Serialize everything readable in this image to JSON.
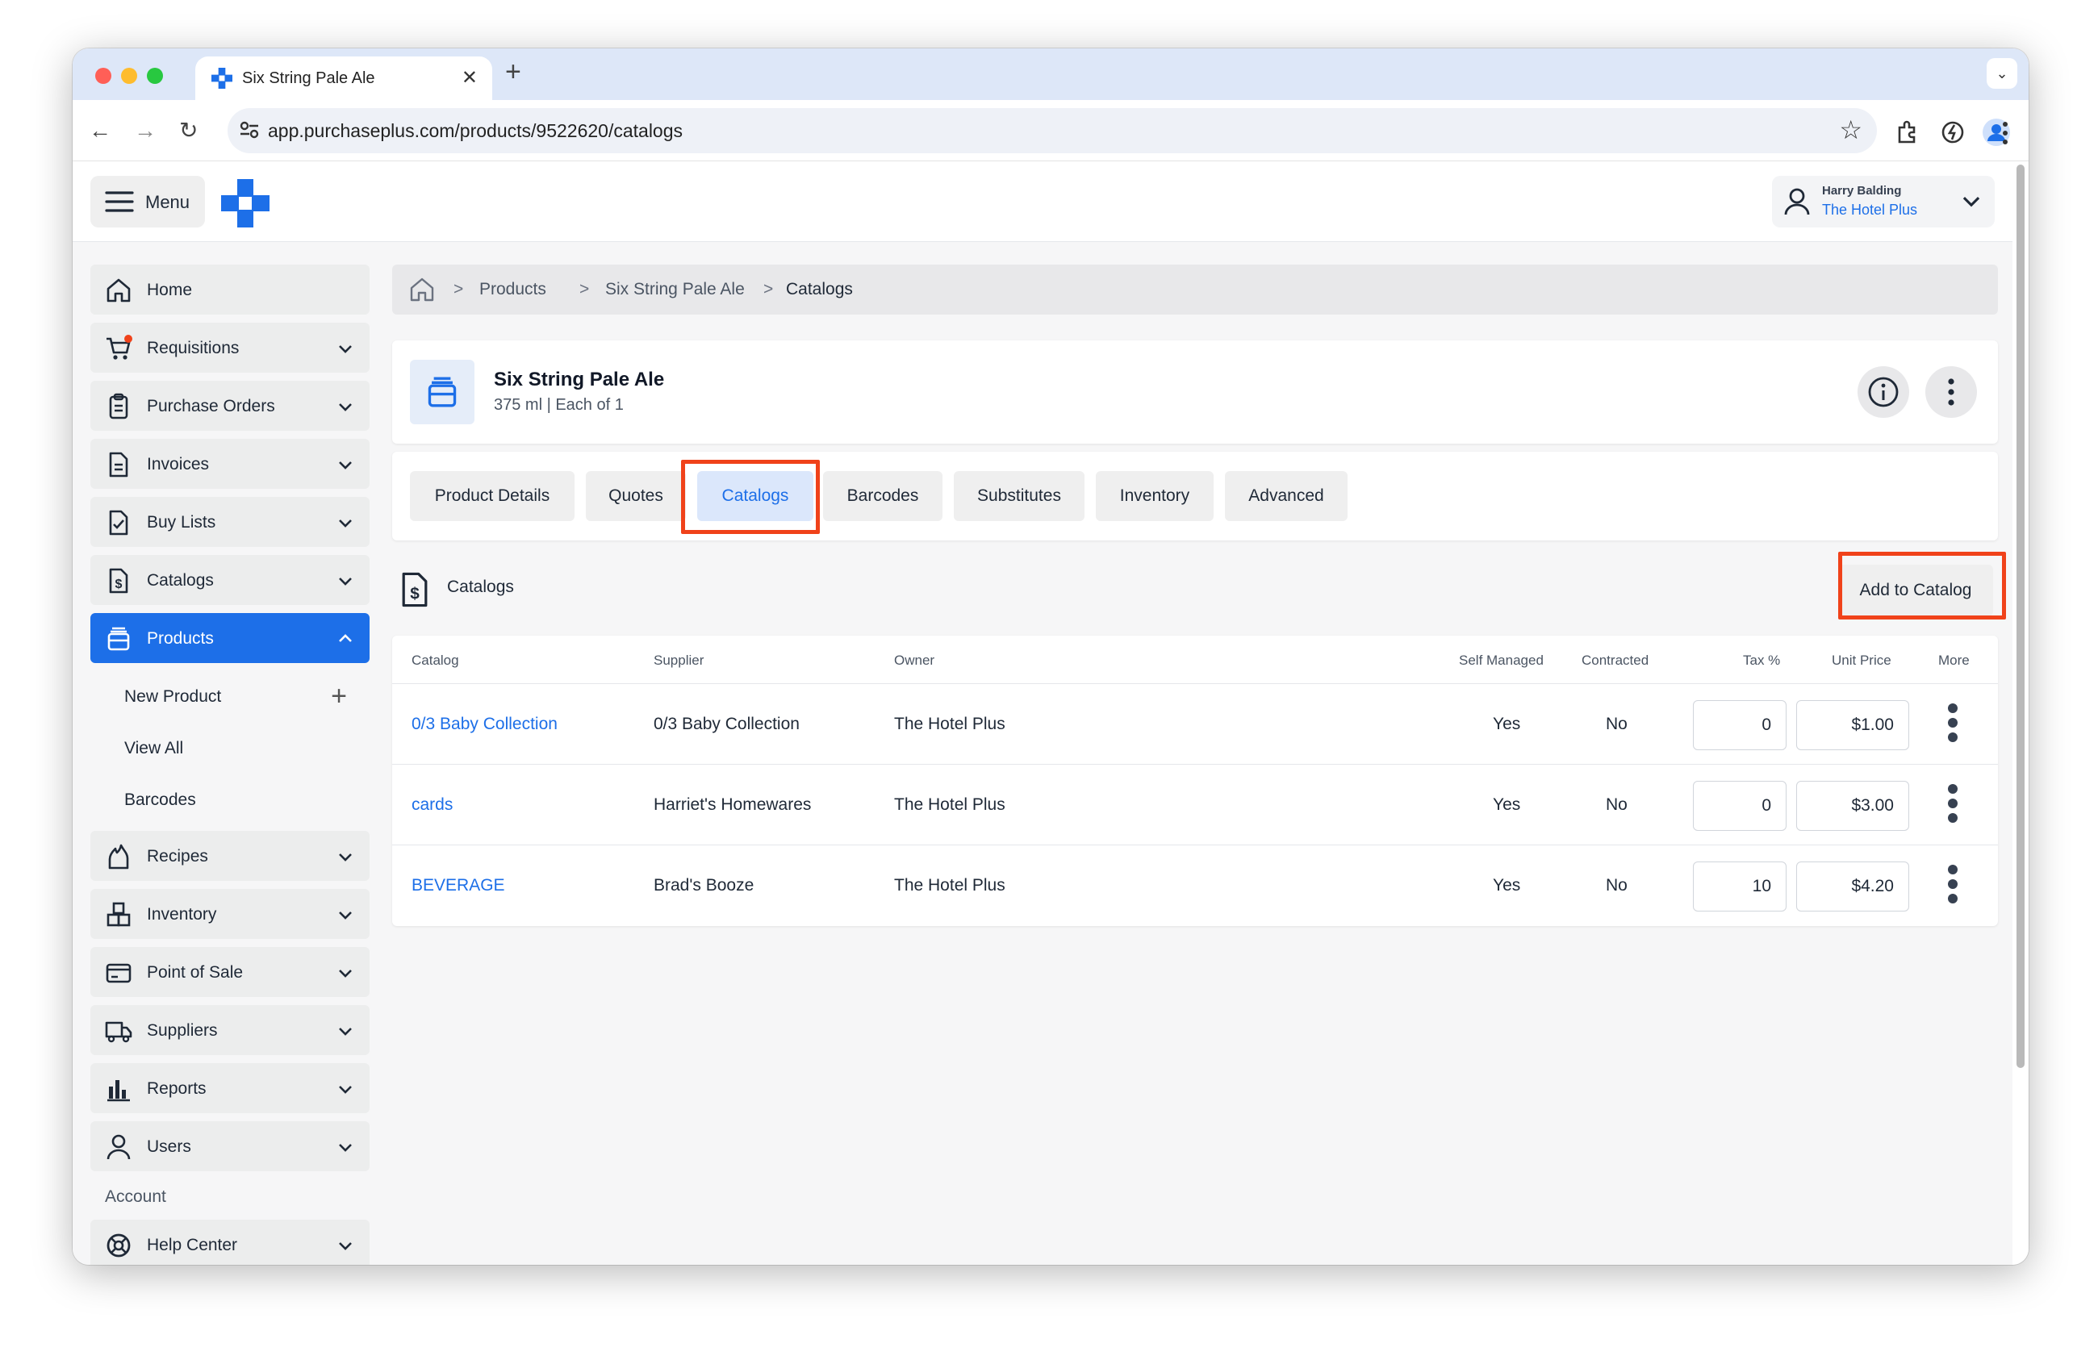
{
  "browser": {
    "tab_title": "Six String Pale Ale",
    "url": "app.purchaseplus.com/products/9522620/catalogs"
  },
  "header": {
    "menu_label": "Menu",
    "user_name": "Harry Balding",
    "user_org": "The Hotel Plus"
  },
  "sidebar": {
    "items": [
      {
        "label": "Home"
      },
      {
        "label": "Requisitions"
      },
      {
        "label": "Purchase Orders"
      },
      {
        "label": "Invoices"
      },
      {
        "label": "Buy Lists"
      },
      {
        "label": "Catalogs"
      },
      {
        "label": "Products"
      },
      {
        "label": "Recipes"
      },
      {
        "label": "Inventory"
      },
      {
        "label": "Point of Sale"
      },
      {
        "label": "Suppliers"
      },
      {
        "label": "Reports"
      },
      {
        "label": "Users"
      }
    ],
    "product_sub": [
      {
        "label": "New Product"
      },
      {
        "label": "View All"
      },
      {
        "label": "Barcodes"
      }
    ],
    "account_heading": "Account",
    "help_center": "Help Center"
  },
  "breadcrumb": [
    "Products",
    "Six String Pale Ale",
    "Catalogs"
  ],
  "product": {
    "name": "Six String Pale Ale",
    "meta": "375 ml | Each of 1"
  },
  "tabs": [
    "Product Details",
    "Quotes",
    "Catalogs",
    "Barcodes",
    "Substitutes",
    "Inventory",
    "Advanced"
  ],
  "catalogs_section": {
    "title": "Catalogs",
    "add_button": "Add to Catalog"
  },
  "table": {
    "columns": [
      "Catalog",
      "Supplier",
      "Owner",
      "Self Managed",
      "Contracted",
      "Tax %",
      "Unit Price",
      "More"
    ],
    "rows": [
      {
        "catalog": "0/3 Baby Collection",
        "supplier": "0/3 Baby Collection",
        "owner": "The Hotel Plus",
        "self_managed": "Yes",
        "contracted": "No",
        "tax": "0",
        "price": "$1.00"
      },
      {
        "catalog": "cards",
        "supplier": "Harriet's Homewares",
        "owner": "The Hotel Plus",
        "self_managed": "Yes",
        "contracted": "No",
        "tax": "0",
        "price": "$3.00"
      },
      {
        "catalog": "BEVERAGE",
        "supplier": "Brad's Booze",
        "owner": "The Hotel Plus",
        "self_managed": "Yes",
        "contracted": "No",
        "tax": "10",
        "price": "$4.20"
      }
    ]
  },
  "colors": {
    "accent": "#1d6fe8",
    "highlight": "#f0421a"
  }
}
